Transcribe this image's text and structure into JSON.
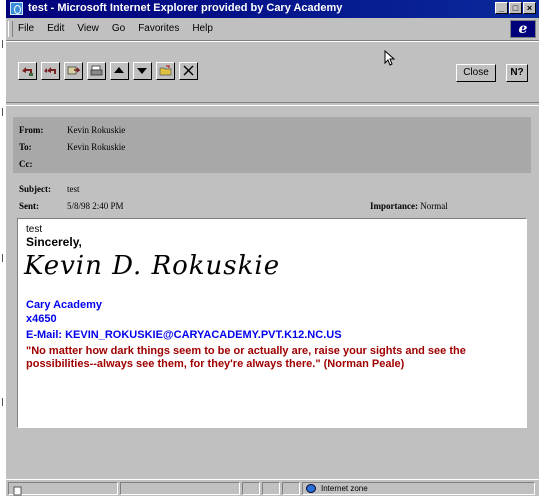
{
  "window": {
    "title": "test - Microsoft Internet Explorer provided by Cary Academy",
    "controls": [
      "_",
      "□",
      "×"
    ]
  },
  "menu": [
    "File",
    "Edit",
    "View",
    "Go",
    "Favorites",
    "Help"
  ],
  "toolbar": {
    "tools": [
      "reply-icon",
      "reply-all-icon",
      "forward-icon",
      "print-icon",
      "previous-icon",
      "next-icon",
      "move-to-folder-icon",
      "delete-icon"
    ],
    "close_label": "Close",
    "help_label": "N?"
  },
  "message": {
    "from_label": "From:",
    "from": "Kevin Rokuskie",
    "to_label": "To:",
    "to": "Kevin Rokuskie",
    "cc_label": "Cc:",
    "cc": "",
    "subject_label": "Subject:",
    "subject": "test",
    "sent_label": "Sent:",
    "sent": "5/8/98 2:40 PM",
    "importance_label": "Importance:",
    "importance": "Normal"
  },
  "body": {
    "first_line": "test",
    "closing": "Sincerely,",
    "signature": "Kevin D. Rokuskie",
    "org": "Cary Academy",
    "ext": "x4650",
    "email": "E-Mail: KEVIN_ROKUSKIE@CARYACADEMY.PVT.K12.NC.US",
    "quote": "\"No matter how dark things seem to be or actually are, raise your sights and see the possibilities--always see them, for they're always there.\" (Norman Peale)"
  },
  "status": {
    "zone": "Internet zone"
  }
}
